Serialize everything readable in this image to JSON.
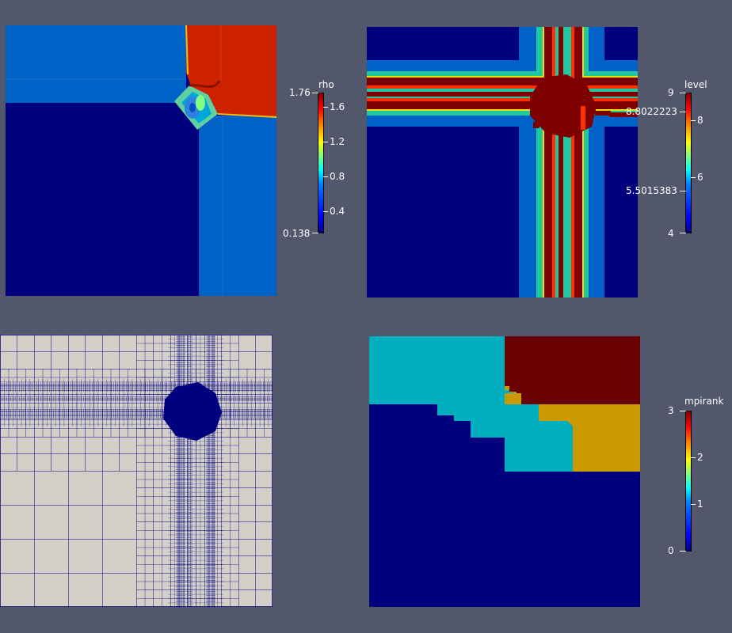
{
  "colorbars": {
    "rho": {
      "title": "rho",
      "max_label": "1.76",
      "min_label": "0.138",
      "ticks": [
        "1.6",
        "1.2",
        "0.8",
        "0.4"
      ]
    },
    "level": {
      "title": "level",
      "max_label": "9",
      "min_label": "4",
      "range_max_label": "8.8022223",
      "range_min_label": "5.5015383",
      "ticks": [
        "8",
        "6"
      ]
    },
    "mpirank": {
      "title": "mpirank",
      "max_label": "3",
      "min_label": "0",
      "ticks": [
        "2",
        "1"
      ]
    }
  },
  "colors": {
    "background": "#52576b",
    "dark_blue": "#00007f",
    "mid_blue": "#0061c6",
    "red": "#cc2200",
    "dark_red": "#6b0000",
    "cyan": "#00aec0",
    "gold": "#c89a00",
    "mesh_fill": "#d4d0c8",
    "mesh_line": "#00007f"
  },
  "views": {
    "rho": "rho",
    "level": "level",
    "mesh": "mesh",
    "mpirank": "mpirank"
  }
}
